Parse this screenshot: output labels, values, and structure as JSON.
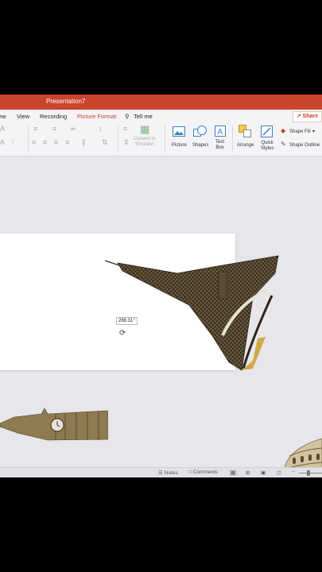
{
  "window": {
    "title": "Presentation7"
  },
  "tabs": [
    {
      "label": "ew"
    },
    {
      "label": "View"
    },
    {
      "label": "Recording"
    },
    {
      "label": "Picture Format"
    },
    {
      "label": "Tell me"
    }
  ],
  "share": {
    "label": "Share"
  },
  "ribbon": {
    "convert_line1": "Convert to",
    "convert_line2": "SmartArt",
    "picture": "Picture",
    "shapes": "Shapes",
    "textbox_line1": "Text",
    "textbox_line2": "Box",
    "arrange": "Arrange",
    "quick_line1": "Quick",
    "quick_line2": "Styles",
    "shape_fill": "Shape Fill",
    "shape_outline": "Shape Outline"
  },
  "canvas": {
    "rotation_readout": "288.31°"
  },
  "statusbar": {
    "notes": "Notes",
    "comments": "Comments"
  },
  "colors": {
    "accent": "#c9452e"
  }
}
